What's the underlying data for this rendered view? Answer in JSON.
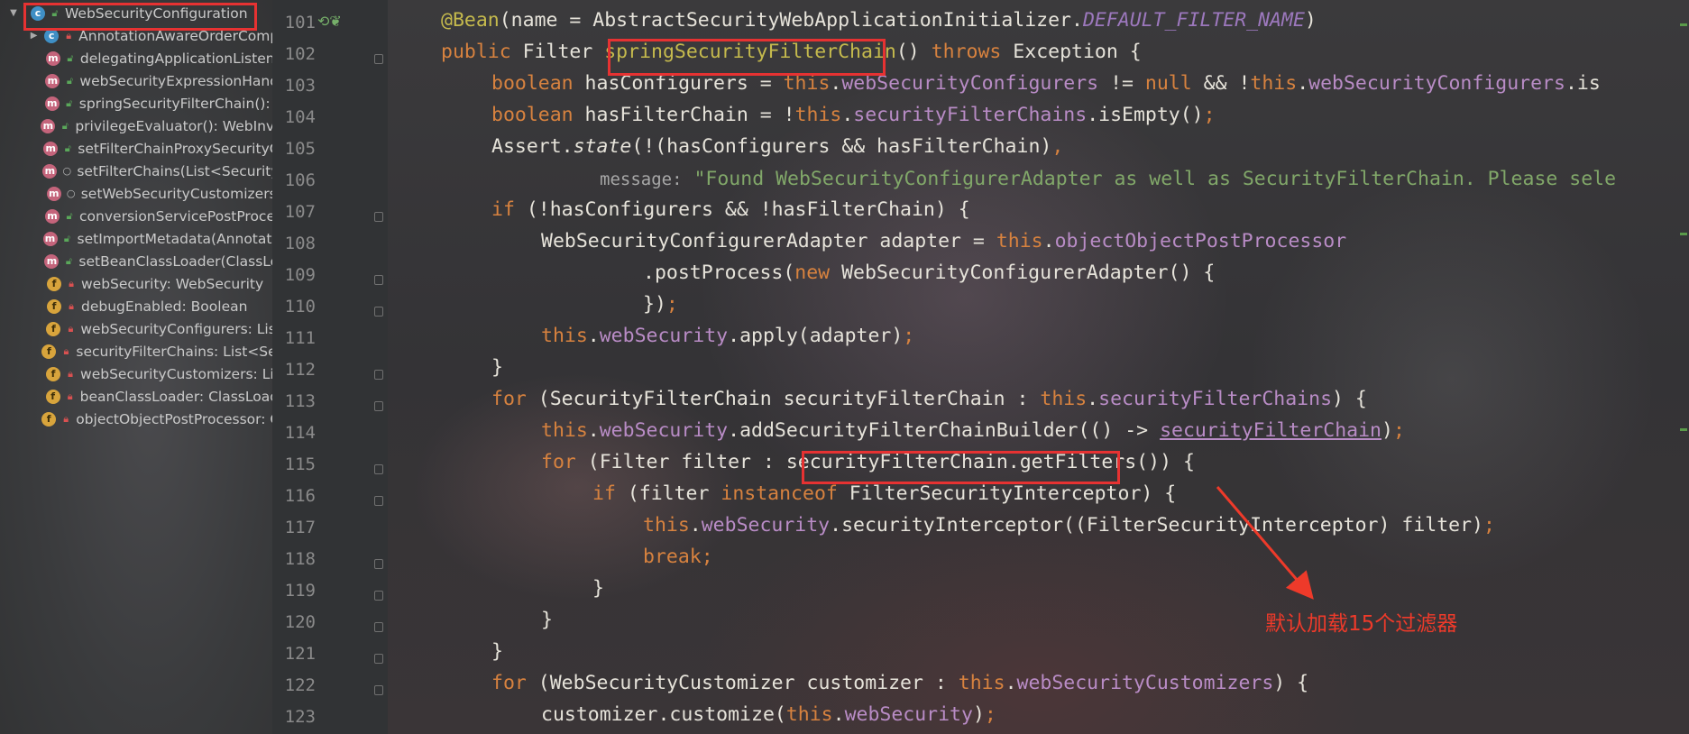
{
  "structure_panel": {
    "root": {
      "label": "WebSecurityConfiguration",
      "icon": "class-icon"
    },
    "items": [
      {
        "label": "AnnotationAwareOrderComparator",
        "icon": "class-icon",
        "visibility": "private",
        "expandable": true
      },
      {
        "label": "delegatingApplicationListener",
        "icon": "method-icon",
        "visibility": "public"
      },
      {
        "label": "webSecurityExpressionHandler",
        "icon": "method-icon",
        "visibility": "public"
      },
      {
        "label": "springSecurityFilterChain(): Filter",
        "icon": "method-icon",
        "visibility": "public"
      },
      {
        "label": "privilegeEvaluator(): WebInvocationPrivilegeEvaluator",
        "icon": "method-icon",
        "visibility": "public"
      },
      {
        "label": "setFilterChainProxySecurityConfigurer",
        "icon": "method-icon",
        "visibility": "public"
      },
      {
        "label": "setFilterChains(List<SecurityFilterChain>)",
        "icon": "method-icon",
        "visibility": "package"
      },
      {
        "label": "setWebSecurityCustomizers",
        "icon": "method-icon",
        "visibility": "package"
      },
      {
        "label": "conversionServicePostProcessor",
        "icon": "method-icon",
        "visibility": "public"
      },
      {
        "label": "setImportMetadata(AnnotationMetadata)",
        "icon": "method-icon",
        "visibility": "public"
      },
      {
        "label": "setBeanClassLoader(ClassLoader)",
        "icon": "method-icon",
        "visibility": "public"
      },
      {
        "label": "webSecurity: WebSecurity",
        "icon": "field-icon",
        "visibility": "private"
      },
      {
        "label": "debugEnabled: Boolean",
        "icon": "field-icon",
        "visibility": "private"
      },
      {
        "label": "webSecurityConfigurers: List",
        "icon": "field-icon",
        "visibility": "private"
      },
      {
        "label": "securityFilterChains: List<SecurityFilterChain>",
        "icon": "field-icon",
        "visibility": "private"
      },
      {
        "label": "webSecurityCustomizers: List",
        "icon": "field-icon",
        "visibility": "private"
      },
      {
        "label": "beanClassLoader: ClassLoader",
        "icon": "field-icon",
        "visibility": "private"
      },
      {
        "label": "objectObjectPostProcessor: ObjectPostProcessor",
        "icon": "field-icon",
        "visibility": "private"
      }
    ]
  },
  "editor": {
    "line_numbers": [
      "101",
      "102",
      "103",
      "104",
      "105",
      "106",
      "107",
      "108",
      "109",
      "110",
      "111",
      "112",
      "113",
      "114",
      "115",
      "116",
      "117",
      "118",
      "119",
      "120",
      "121",
      "122",
      "123"
    ],
    "line_101": {
      "annotation": "@Bean",
      "p1": "(name = AbstractSecurityWebApplicationInitializer.",
      "constant": "DEFAULT_FILTER_NAME",
      "p2": ")"
    },
    "line_102": {
      "kw_public": "public",
      "type": " Filter ",
      "method": "springSecurityFilterChain",
      "p1": "() ",
      "kw_throws": "throws",
      "p2": " Exception {"
    },
    "line_103": {
      "kw": "boolean",
      "p1": " hasConfigurers = ",
      "kw_this": "this",
      "p2": ".",
      "field": "webSecurityConfigurers",
      "p3": " != ",
      "kw_null": "null",
      "p4": " && !",
      "kw_this2": "this",
      "p5": ".",
      "field2": "webSecurityConfigurers",
      "p6": ".is"
    },
    "line_104": {
      "kw": "boolean",
      "p1": " hasFilterChain = !",
      "kw_this": "this",
      "p2": ".",
      "field": "securityFilterChains",
      "p3": ".isEmpty()",
      "semi": ";"
    },
    "line_105": {
      "p1": "Assert.",
      "italic": "state",
      "p2": "(!(hasConfigurers && hasFilterChain)",
      "comma": ","
    },
    "line_106": {
      "hint": "message:",
      "string": "\"Found WebSecurityConfigurerAdapter as well as SecurityFilterChain. Please sele"
    },
    "line_107": {
      "kw": "if",
      "p1": " (!hasConfigurers && !hasFilterChain) {"
    },
    "line_108": {
      "p1": "WebSecurityConfigurerAdapter adapter = ",
      "kw_this": "this",
      "p2": ".",
      "field": "objectObjectPostProcessor"
    },
    "line_109": {
      "p1": ".postProcess(",
      "kw_new": "new",
      "p2": " WebSecurityConfigurerAdapter() {"
    },
    "line_110": {
      "p1": "})",
      "semi": ";"
    },
    "line_111": {
      "kw_this": "this",
      "p1": ".",
      "field": "webSecurity",
      "p2": ".apply(adapter)",
      "semi": ";"
    },
    "line_112": {
      "p1": "}"
    },
    "line_113": {
      "kw": "for",
      "p1": " (SecurityFilterChain securityFilterChain : ",
      "kw_this": "this",
      "p2": ".",
      "field": "securityFilterChains",
      "p3": ") {"
    },
    "line_114": {
      "kw_this": "this",
      "p1": ".",
      "field": "webSecurity",
      "p2": ".addSecurityFilterChainBuilder(() -> ",
      "underlined": "securityFilterChain",
      "p3": ")",
      "semi": ";"
    },
    "line_115": {
      "kw": "for",
      "p1": " (Filter filter : ",
      "boxed": "securityFilterChain.getFilters()",
      "p2": ") {"
    },
    "line_116": {
      "kw": "if",
      "p1": " (filter ",
      "kw_instanceof": "instanceof",
      "p2": " FilterSecurityInterceptor) {"
    },
    "line_117": {
      "kw_this": "this",
      "p1": ".",
      "field": "webSecurity",
      "p2": ".securityInterceptor((FilterSecurityInterceptor) filter)",
      "semi": ";"
    },
    "line_118": {
      "kw": "break",
      "semi": ";"
    },
    "line_119": {
      "p1": "}"
    },
    "line_120": {
      "p1": "}"
    },
    "line_121": {
      "p1": "}"
    },
    "line_122": {
      "kw": "for",
      "p1": " (WebSecurityCustomizer customizer : ",
      "kw_this": "this",
      "p2": ".",
      "field": "webSecurityCustomizers",
      "p3": ") {"
    },
    "line_123": {
      "p1": "customizer.customize(",
      "kw_this": "this",
      "p2": ".",
      "field": "webSecurity",
      "p3": ")",
      "semi": ";"
    }
  },
  "annotation_text": "默认加载15个过滤器",
  "colors": {
    "highlight_box": "#e63232",
    "annotation": "#ee3a2a",
    "keyword": "#d7823f",
    "field": "#b98cc6",
    "string": "#81a769"
  }
}
